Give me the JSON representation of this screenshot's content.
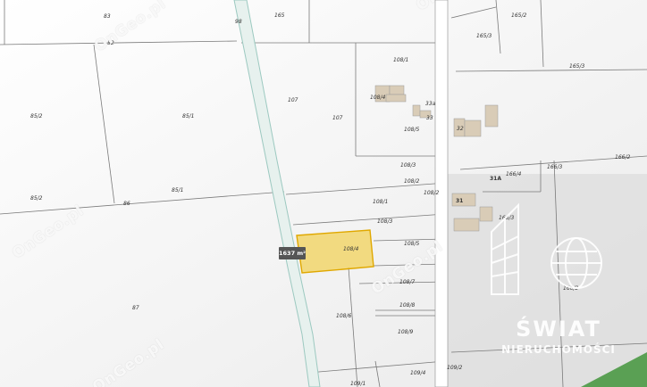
{
  "map": {
    "area_label": "1637 m²",
    "parcel_numbers": [
      "83",
      "52",
      "98",
      "165",
      "165/2",
      "165/3",
      "165/3",
      "108/1",
      "108/4",
      "33a",
      "33",
      "107",
      "107",
      "108/5",
      "32",
      "85/2",
      "85/1",
      "85/1",
      "108/3",
      "108/2",
      "31A",
      "166/4",
      "166/3",
      "166/2",
      "108/1",
      "108/2",
      "31",
      "166/3",
      "108/3",
      "108/4",
      "108/5",
      "86",
      "85/2",
      "108/7",
      "108/8",
      "87",
      "166/2",
      "108/6",
      "108/9",
      "109/4",
      "109/1",
      "109/2"
    ],
    "watermark_text": "OnGeo.pl"
  },
  "colors": {
    "highlight_fill": "#f1d25a",
    "highlight_stroke": "#e0a800",
    "river": "#9cc9c0",
    "green": "#5aa054"
  },
  "brand": {
    "line1": "ŚWIAT",
    "line2": "NIERUCHOMOŚCI"
  }
}
